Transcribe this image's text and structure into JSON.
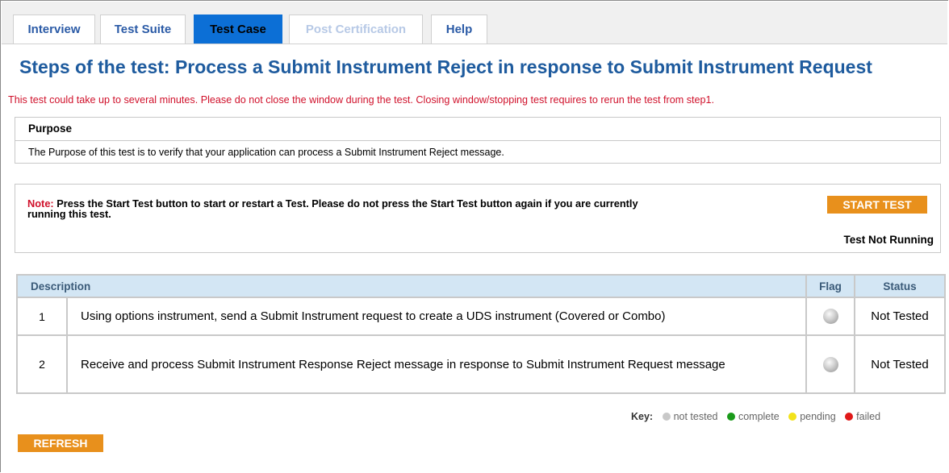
{
  "tabs": [
    {
      "label": "Interview",
      "state": "normal"
    },
    {
      "label": "Test Suite",
      "state": "normal"
    },
    {
      "label": "Test Case",
      "state": "active"
    },
    {
      "label": "Post Certification",
      "state": "disabled"
    },
    {
      "label": "Help",
      "state": "normal"
    }
  ],
  "title": "Steps of the test: Process a Submit Instrument Reject in response to Submit Instrument Request",
  "warning": "This test could take up to several minutes. Please do not close the window during the test. Closing window/stopping test requires to rerun the test from step1.",
  "purpose": {
    "heading": "Purpose",
    "text": "The Purpose of this test is to verify that your application can process a Submit Instrument Reject message."
  },
  "note": {
    "label": "Note:",
    "text": " Press the Start Test button to start or restart a Test. Please do not press the Start Test button again if you are currently running this test.",
    "start_button": "START TEST",
    "run_status": "Test Not Running"
  },
  "steps_table": {
    "headers": {
      "description": "Description",
      "flag": "Flag",
      "status": "Status"
    },
    "rows": [
      {
        "num": "1",
        "description": "Using options instrument, send a Submit Instrument request to create a UDS instrument (Covered or Combo)",
        "flag": "not-tested",
        "status": "Not Tested"
      },
      {
        "num": "2",
        "description": "Receive and process Submit Instrument Response Reject message in response to Submit Instrument Request message",
        "flag": "not-tested",
        "status": "Not Tested"
      }
    ]
  },
  "key": {
    "label": "Key:",
    "items": [
      {
        "label": "not tested",
        "color": "#c8c8c8"
      },
      {
        "label": "complete",
        "color": "#1a9a1a"
      },
      {
        "label": "pending",
        "color": "#f2e21a"
      },
      {
        "label": "failed",
        "color": "#e01818"
      }
    ]
  },
  "refresh_button": "REFRESH",
  "colors": {
    "accent_orange": "#e8901c",
    "title_blue": "#1e5b9e",
    "warning_red": "#d0112b",
    "active_tab_blue": "#0c6fd6"
  }
}
